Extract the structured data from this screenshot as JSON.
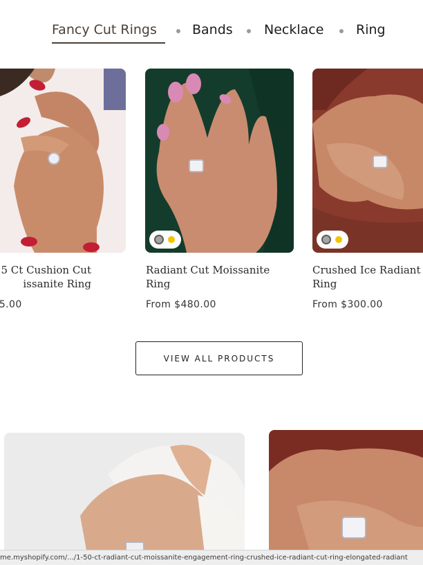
{
  "tabs": [
    {
      "label": "Fancy Cut Rings",
      "active": true
    },
    {
      "label": "Bands",
      "active": false
    },
    {
      "label": "Necklace",
      "active": false
    },
    {
      "label": "Ring",
      "active": false
    }
  ],
  "products": [
    {
      "title_line1": "5 Ct Cushion Cut",
      "title_line2": "issanite Ring",
      "price": ".5.00",
      "swatches": []
    },
    {
      "title_line1": "Radiant Cut Moissanite",
      "title_line2": "Ring",
      "price": "From $480.00",
      "swatches": [
        "silver",
        "gold"
      ]
    },
    {
      "title_line1": "Crushed Ice Radiant C",
      "title_line2": "Ring",
      "price": "From $300.00",
      "swatches": [
        "silver",
        "gold"
      ]
    }
  ],
  "view_all_label": "VIEW ALL PRODUCTS",
  "status_bar_url": "me.myshopify.com/.../1-50-ct-radiant-cut-moissanite-engagement-ring-crushed-ice-radiant-cut-ring-elongated-radiant",
  "colors": {
    "tab_underline": "#4a4038",
    "swatch_silver": "#a5a5a5",
    "swatch_gold": "#f2c500"
  }
}
